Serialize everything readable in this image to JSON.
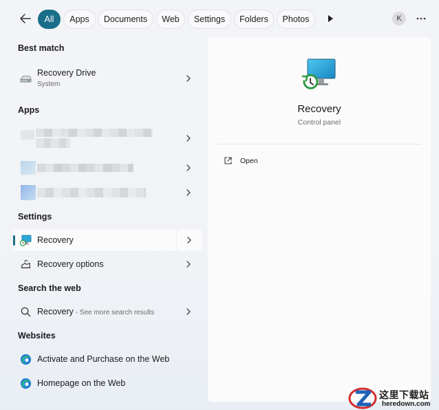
{
  "filters": {
    "items": [
      "All",
      "Apps",
      "Documents",
      "Web",
      "Settings",
      "Folders",
      "Photos"
    ],
    "active": "All",
    "avatar_initial": "K"
  },
  "sections": {
    "best_match": "Best match",
    "apps": "Apps",
    "settings": "Settings",
    "search_web": "Search the web",
    "websites": "Websites"
  },
  "best_match": {
    "title": "Recovery Drive",
    "subtitle": "System",
    "icon": "drive-icon"
  },
  "settings_items": [
    {
      "label": "Recovery",
      "icon": "recovery-monitor-icon",
      "selected": true
    },
    {
      "label": "Recovery options",
      "icon": "recovery-options-icon",
      "selected": false
    }
  ],
  "web_search": {
    "query": "Recovery",
    "hint": "- See more search results",
    "icon": "search-icon"
  },
  "websites": [
    {
      "label": "Activate and Purchase on the Web",
      "icon": "edge-icon"
    },
    {
      "label": "Homepage on the Web",
      "icon": "edge-icon"
    }
  ],
  "preview": {
    "title": "Recovery",
    "subtitle": "Control panel",
    "actions": [
      {
        "label": "Open",
        "icon": "open-external-icon"
      }
    ]
  },
  "watermark": {
    "text_cn": "这里下载站",
    "text_en": "heredown.com"
  },
  "colors": {
    "accent": "#1b6e8a",
    "background": "#f2f3f6",
    "pane": "#fbfbfc"
  }
}
